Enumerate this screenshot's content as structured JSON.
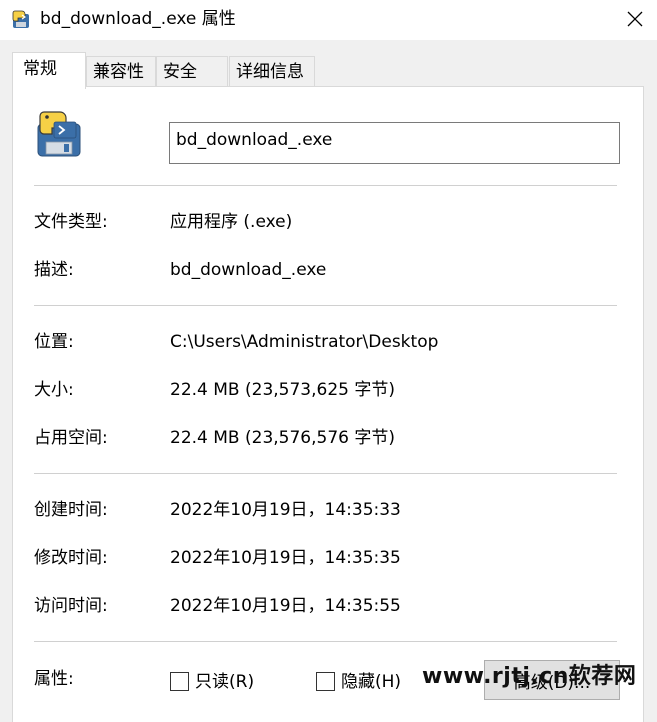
{
  "window": {
    "title": "bd_download_.exe 属性"
  },
  "tabs": [
    {
      "label": "常规",
      "active": true
    },
    {
      "label": "兼容性",
      "active": false
    },
    {
      "label": "安全",
      "active": false
    },
    {
      "label": "详细信息",
      "active": false
    }
  ],
  "general": {
    "file_name": "bd_download_.exe",
    "type_label": "文件类型:",
    "type_value": "应用程序 (.exe)",
    "desc_label": "描述:",
    "desc_value": "bd_download_.exe",
    "location_label": "位置:",
    "location_value": "C:\\Users\\Administrator\\Desktop",
    "size_label": "大小:",
    "size_value": "22.4 MB (23,573,625 字节)",
    "size_on_disk_label": "占用空间:",
    "size_on_disk_value": "22.4 MB (23,576,576 字节)",
    "created_label": "创建时间:",
    "created_value": "2022年10月19日，14:35:33",
    "modified_label": "修改时间:",
    "modified_value": "2022年10月19日，14:35:35",
    "accessed_label": "访问时间:",
    "accessed_value": "2022年10月19日，14:35:55",
    "attributes_label": "属性:",
    "readonly_label": "只读(R)",
    "readonly_checked": false,
    "hidden_label": "隐藏(H)",
    "hidden_checked": false,
    "advanced_label": "高级(D)..."
  },
  "watermark": {
    "text": "www.rjtj.cn软荐网"
  },
  "icons": {
    "title": "python-file-icon",
    "file": "python-file-icon",
    "close": "close-icon"
  },
  "colors": {
    "panel_bg": "#ffffff",
    "dialog_bg": "#f0f0f0",
    "divider": "#d0d0d0",
    "python_blue": "#3b6fa8",
    "python_yellow": "#f6d046"
  }
}
